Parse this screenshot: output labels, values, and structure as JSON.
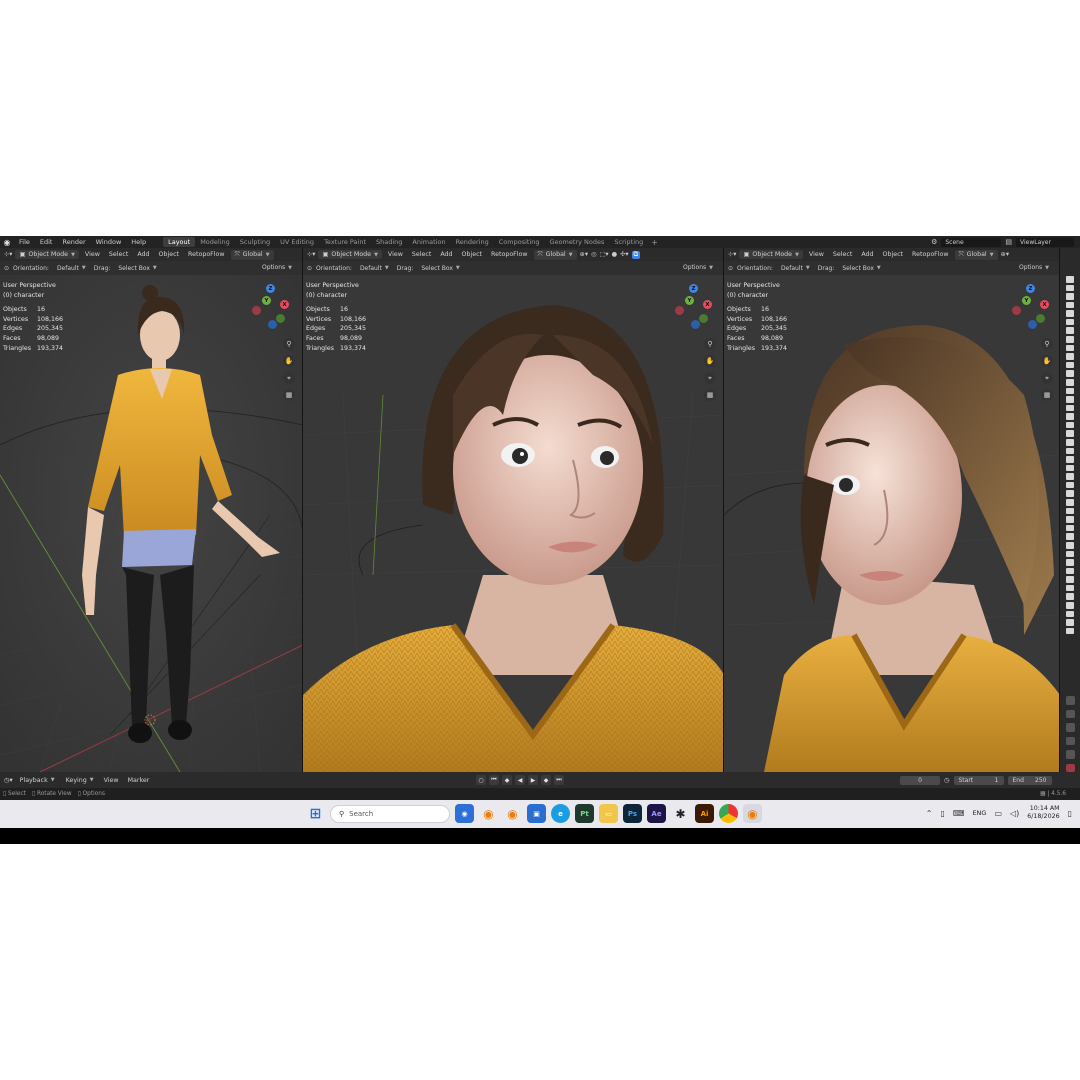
{
  "menu": {
    "items": [
      "File",
      "Edit",
      "Render",
      "Window",
      "Help"
    ],
    "workspaces": [
      "Layout",
      "Modeling",
      "Sculpting",
      "UV Editing",
      "Texture Paint",
      "Shading",
      "Animation",
      "Rendering",
      "Compositing",
      "Geometry Nodes",
      "Scripting"
    ],
    "active_workspace": "Layout",
    "add_tab": "+",
    "scene_field": "Scene",
    "view_layer_field": "ViewLayer"
  },
  "viewport_header": {
    "mode": "Object Mode",
    "items": [
      "View",
      "Select",
      "Add",
      "Object"
    ],
    "addon": "RetopoFlow",
    "transform": "Global",
    "orientation_label": "Orientation:",
    "orientation_value": "Default",
    "drag_label": "Drag:",
    "drag_value": "Select Box",
    "options": "Options"
  },
  "overlay": {
    "perspective": "User Perspective",
    "collection": "(0) character",
    "stats": [
      {
        "label": "Objects",
        "value": "16"
      },
      {
        "label": "Vertices",
        "value": "108,166"
      },
      {
        "label": "Edges",
        "value": "205,345"
      },
      {
        "label": "Faces",
        "value": "98,089"
      },
      {
        "label": "Triangles",
        "value": "193,374"
      }
    ]
  },
  "gizmo": {
    "x": "X",
    "y": "Y",
    "z": "Z"
  },
  "timeline": {
    "playback": "Playback",
    "keying": "Keying",
    "view": "View",
    "marker": "Marker",
    "current_frame": "0",
    "start_label": "Start",
    "start_value": "1",
    "end_label": "End",
    "end_value": "250"
  },
  "statusbar": {
    "select": "Select",
    "rotate": "Rotate View",
    "options": "Options",
    "version": "4.5.6"
  },
  "taskbar": {
    "search_placeholder": "Search",
    "lang": "ENG",
    "time": "10:14 AM",
    "date": "6/18/2026",
    "icons": [
      {
        "name": "pt-icon",
        "label": "Pt",
        "color": "#1f3a2c"
      },
      {
        "name": "ps-icon",
        "label": "Ps",
        "color": "#0d2538"
      },
      {
        "name": "ae-icon",
        "label": "Ae",
        "color": "#1c1446"
      },
      {
        "name": "ai-icon",
        "label": "Ai",
        "color": "#3a1a05"
      }
    ]
  },
  "colors": {
    "accent_blue": "#3f86e8",
    "axis_red": "#e84a5f",
    "axis_green": "#6cb33e",
    "sweater": "#e0a838"
  }
}
